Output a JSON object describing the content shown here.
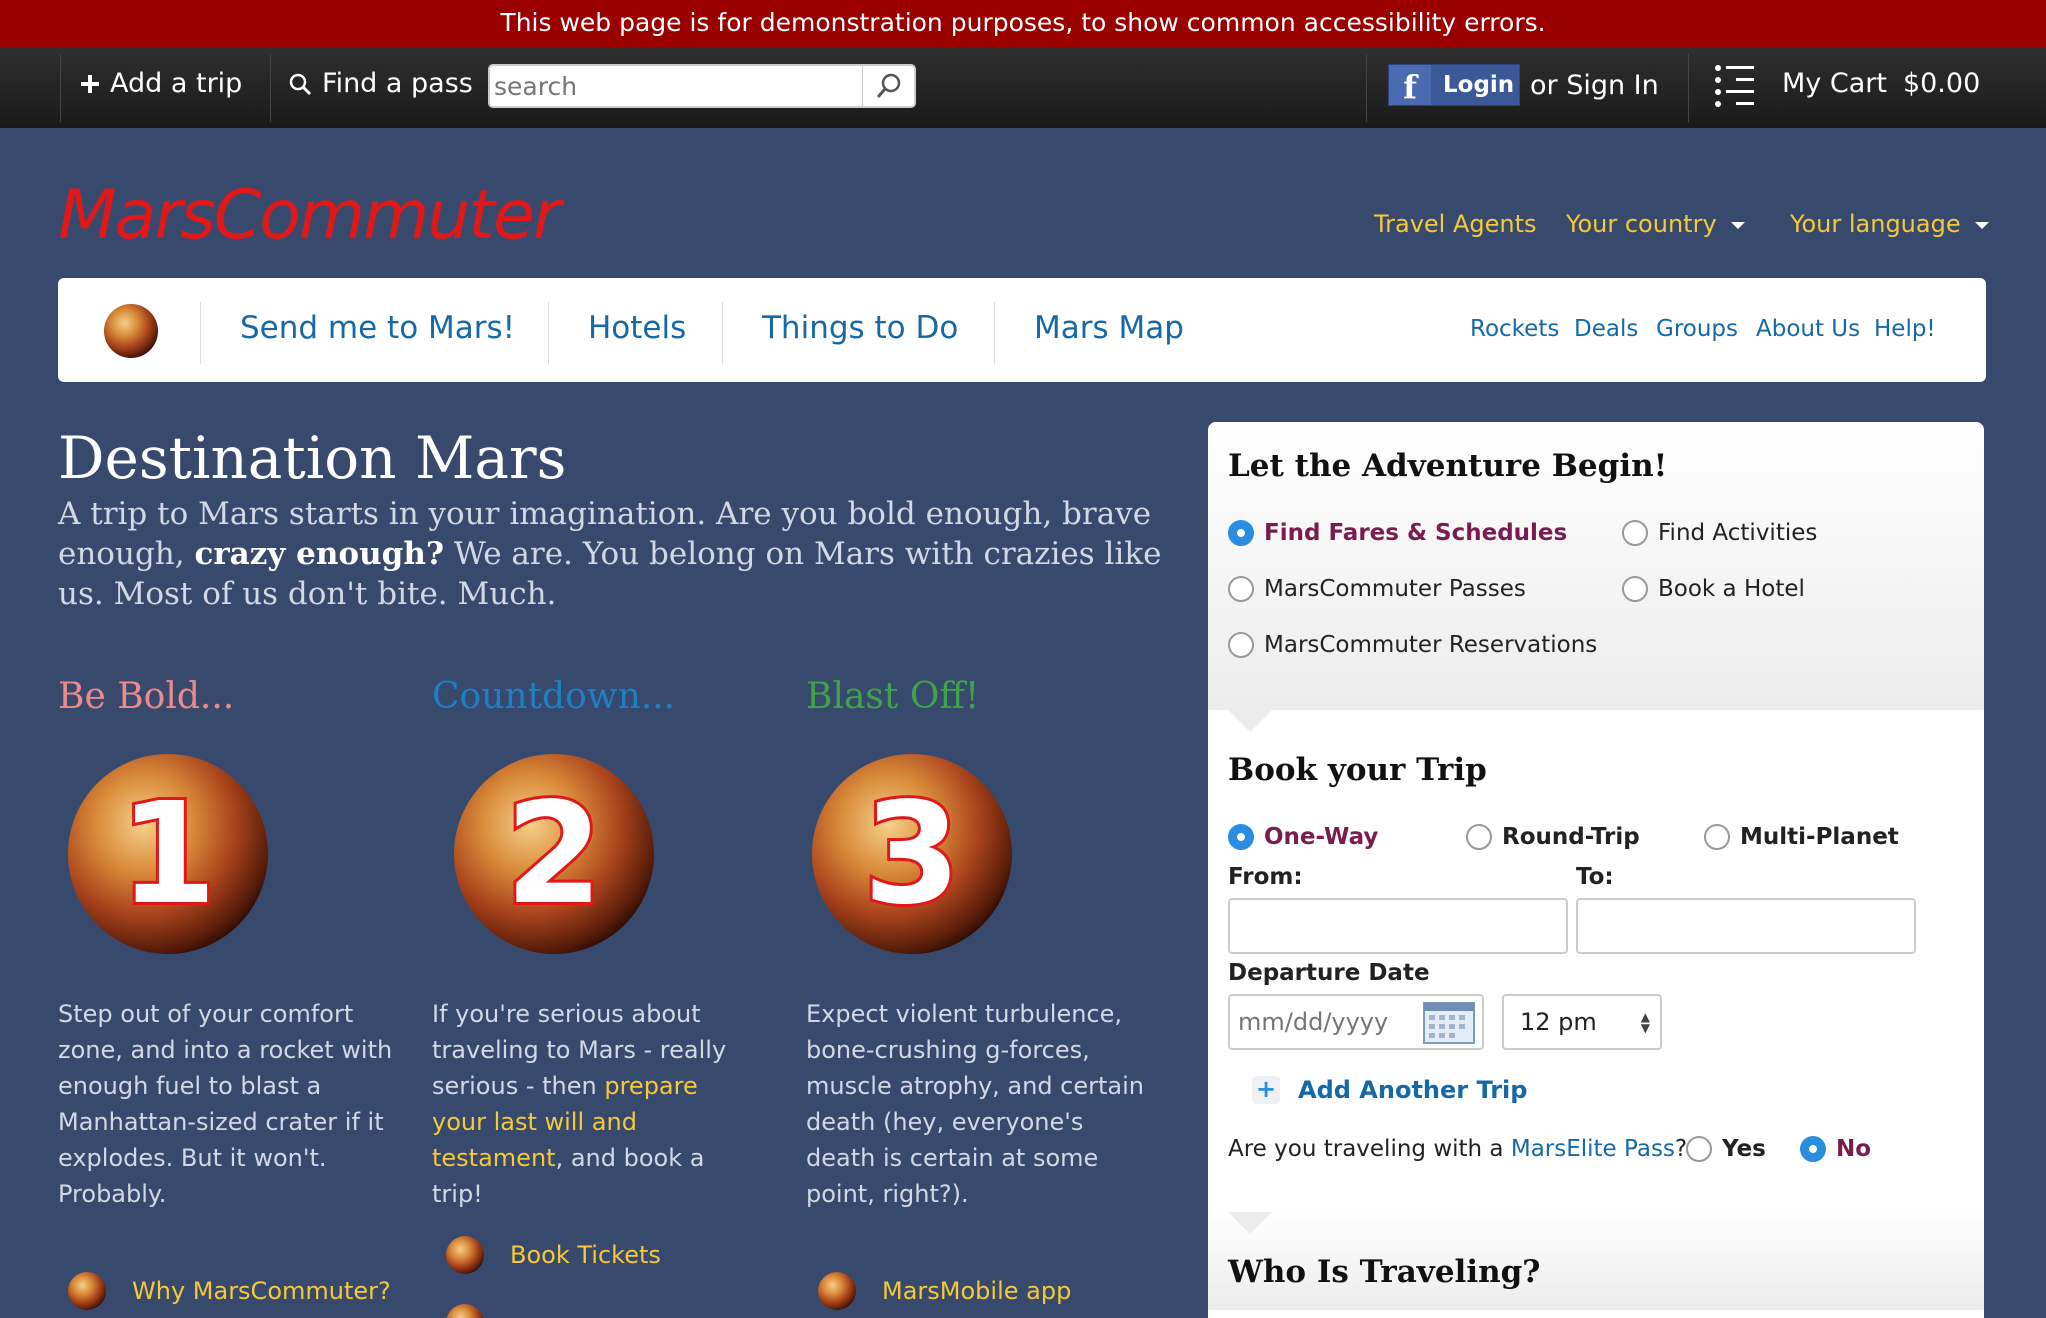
{
  "banner": "This web page is for demonstration purposes, to show common accessibility errors.",
  "topbar": {
    "add_trip": "Add a trip",
    "find_pass": "Find a pass",
    "search_placeholder": "search",
    "login": "Login",
    "sign_in": "or Sign In",
    "cart_label": "My Cart",
    "cart_amount": "$0.00"
  },
  "brand": {
    "logo": "MarsCommuter",
    "logo_color": "#e01818"
  },
  "utility": {
    "travel_agents": "Travel Agents",
    "country": "Your country",
    "language": "Your language"
  },
  "nav": {
    "main": [
      "Send me to Mars!",
      "Hotels",
      "Things to Do",
      "Mars Map"
    ],
    "secondary": [
      "Rockets",
      "Deals",
      "Groups",
      "About Us",
      "Help!"
    ]
  },
  "hero": {
    "title": "Destination Mars",
    "sub_a": "A trip to Mars starts in your imagination. Are you bold enough, brave enough,",
    "sub_b": "crazy enough?",
    "sub_c": "We are. You belong on Mars with crazies like us. Most of us don't bite. Much."
  },
  "steps": [
    {
      "title": "Be Bold...",
      "color": "#f08a8a",
      "number": "1",
      "text": "Step out of your comfort zone, and into a rocket with enough fuel to blast a Manhattan-sized crater if it explodes. But it won't. Probably.",
      "link": "Why MarsCommuter?"
    },
    {
      "title": "Countdown...",
      "color": "#1e7fc6",
      "number": "2",
      "text_a": "If you're serious about traveling to Mars - really serious - then",
      "text_link": "prepare your last will and testament",
      "text_b": ", and book a trip!",
      "link": "Book Tickets"
    },
    {
      "title": "Blast Off!",
      "color": "#3fa34a",
      "number": "3",
      "text": "Expect violent turbulence, bone-crushing g-forces, muscle atrophy, and certain death (hey, everyone's death is certain at some point, right?).",
      "link": "MarsMobile app"
    }
  ],
  "panel": {
    "heading": "Let the Adventure Begin!",
    "search_types": [
      "Find Fares & Schedules",
      "Find Activities",
      "MarsCommuter Passes",
      "Book a Hotel",
      "MarsCommuter Reservations"
    ],
    "book_heading": "Book your Trip",
    "trip_types": [
      "One-Way",
      "Round-Trip",
      "Multi-Planet"
    ],
    "from_label": "From:",
    "to_label": "To:",
    "from_value": "",
    "to_value": "",
    "date_label": "Departure Date",
    "date_placeholder": "mm/dd/yyyy",
    "time_value": "12 pm",
    "add_trip": "Add Another Trip",
    "elite_a": "Are you traveling with a",
    "elite_link": "MarsElite Pass",
    "elite_q": "?",
    "yes": "Yes",
    "no": "No",
    "who_heading": "Who Is Traveling?"
  },
  "colors": {
    "background": "#374a6d",
    "accent": "#f6c938",
    "link": "#1569a8",
    "banner": "#9a0000"
  }
}
